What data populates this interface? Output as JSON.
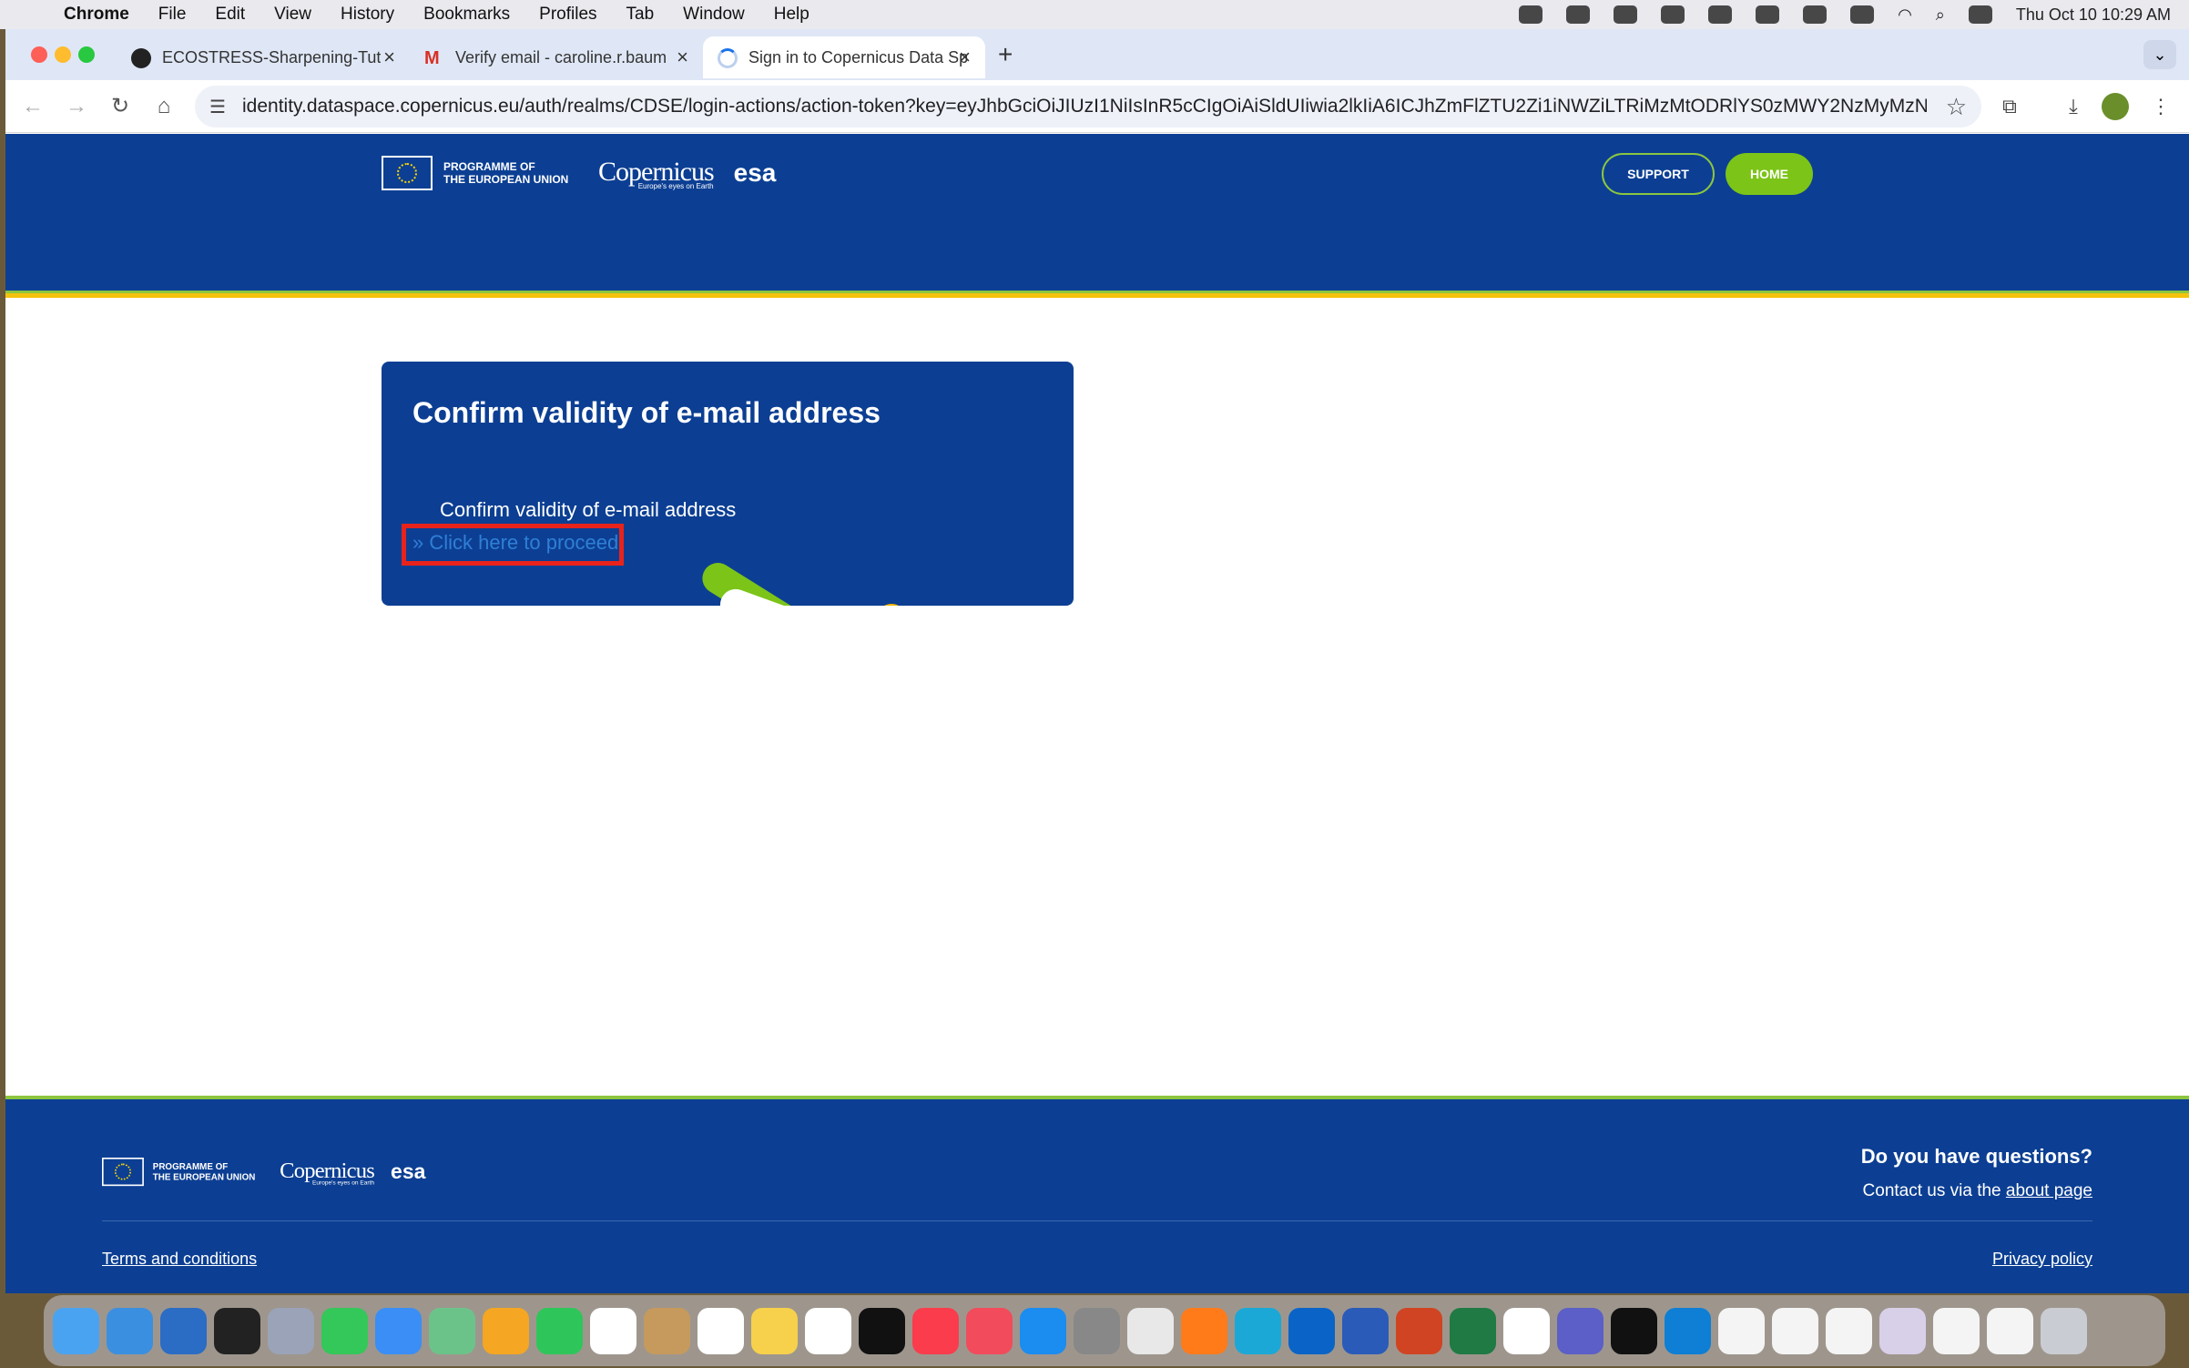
{
  "menubar": {
    "app": "Chrome",
    "items": [
      "File",
      "Edit",
      "View",
      "History",
      "Bookmarks",
      "Profiles",
      "Tab",
      "Window",
      "Help"
    ],
    "clock": "Thu Oct 10  10:29 AM"
  },
  "browser": {
    "tabs": [
      {
        "label": "ECOSTRESS-Sharpening-Tut",
        "icon": "github-icon"
      },
      {
        "label": "Verify email - caroline.r.baum",
        "icon": "gmail-icon"
      },
      {
        "label": "Sign in to Copernicus Data Sp",
        "icon": "loading-icon"
      }
    ],
    "url": "identity.dataspace.copernicus.eu/auth/realms/CDSE/login-actions/action-token?key=eyJhbGciOiJIUzI1NiIsInR5cCIgOiAiSldUIiwia2lkIiA6ICJhZmFlZTU2Zi1iNWZiLTRiMzMtODRlYS0zMWY2NzMyMzNhNzgifQ.e..."
  },
  "header": {
    "programme_line1": "PROGRAMME OF",
    "programme_line2": "THE EUROPEAN UNION",
    "copernicus": "Copernicus",
    "copernicus_tagline": "Europe's eyes on Earth",
    "esa": "esa",
    "support": "SUPPORT",
    "home": "HOME"
  },
  "card": {
    "title": "Confirm validity of e-mail address",
    "text": "Confirm validity of e-mail address",
    "link": "» Click here to proceed"
  },
  "footer": {
    "question": "Do you have questions?",
    "contact_prefix": "Contact us via the ",
    "contact_link": "about page",
    "terms": "Terms and conditions",
    "privacy": "Privacy policy"
  },
  "colors": {
    "brand_blue": "#0c3f93",
    "brand_green": "#7cc418",
    "brand_yellow": "#f4b400",
    "highlight_red": "#e8231b"
  }
}
